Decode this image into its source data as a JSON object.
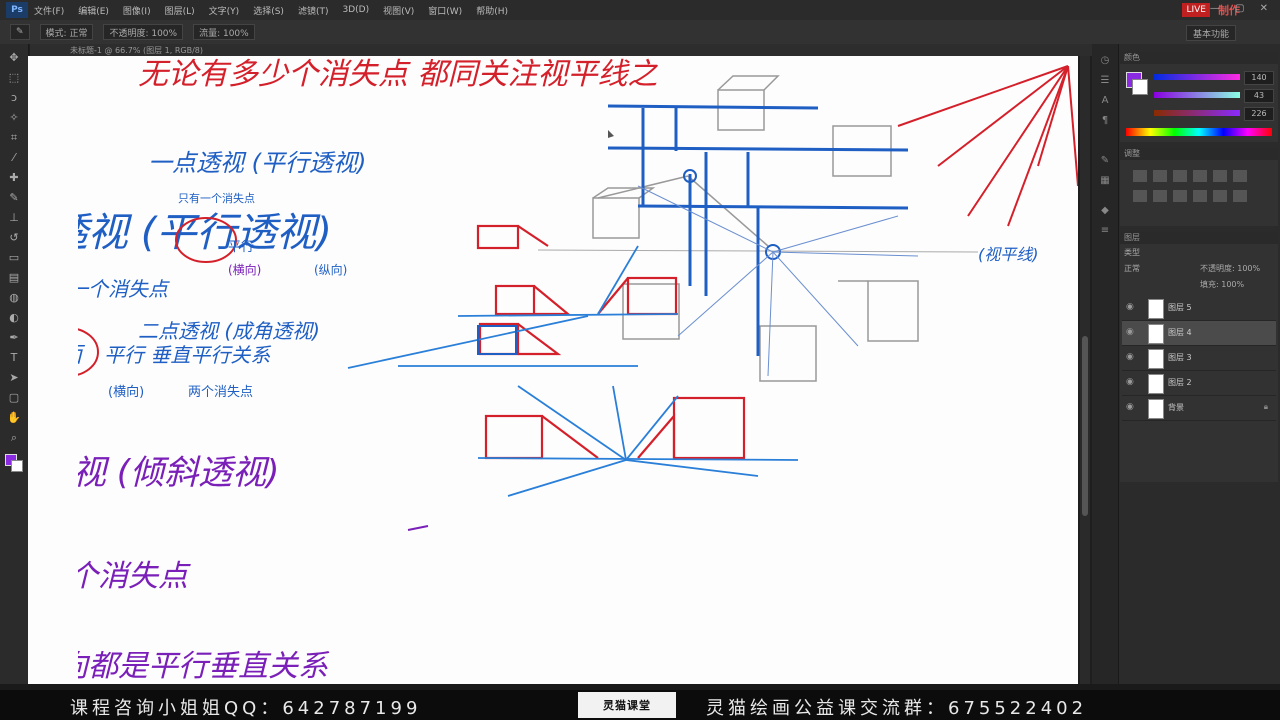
{
  "app": {
    "menus": [
      "文件(F)",
      "编辑(E)",
      "图像(I)",
      "图层(L)",
      "文字(Y)",
      "选择(S)",
      "滤镜(T)",
      "3D(D)",
      "视图(V)",
      "窗口(W)",
      "帮助(H)"
    ],
    "live_badge": "LIVE",
    "live_label": "制作",
    "window_controls": "— ▢ ✕"
  },
  "options": {
    "mode_label": "模式: 正常",
    "opacity_label": "不透明度: 100%",
    "flow_label": "流量: 100%",
    "workspace": "基本功能"
  },
  "document": {
    "tab_title": "未标题-1 @ 66.7% (图层 1, RGB/8)"
  },
  "canvas": {
    "heading_red": "无论有多少个消失点 都同关注视平线之",
    "line_one_point": "一点透视 (平行透视)",
    "note_one_vp": "只有一个消失点",
    "line_big_one_point": "透视 (平行透视)",
    "line_one_vp_left": "有一个消失点",
    "label_horizontal": "(横向)",
    "label_vertical": "(纵向)",
    "label_parallel": "平行",
    "line_two_point": "二点透视 (成角透视)",
    "line_face": "对面",
    "line_parallel_vertical": "平行 垂直平行关系",
    "label_horiz2": "(横向)",
    "label_two_vp": "两个消失点",
    "line_three_point": "透视 (倾斜透视)",
    "line_two_vp": "两个消失点",
    "line_all_parallel": "纵向都是平行垂直关系",
    "label_horizon": "(视平线)"
  },
  "panels": {
    "color_tab": "颜色",
    "r_value": "140",
    "g_value": "43",
    "b_value": "226",
    "adjust_tab": "调整",
    "layers_tab": "图层",
    "kind_label": "类型",
    "blend_mode": "正常",
    "opacity": "不透明度: 100%",
    "fill": "填充: 100%",
    "layers": [
      {
        "name": "图层 5",
        "active": false
      },
      {
        "name": "图层 4",
        "active": true
      },
      {
        "name": "图层 3",
        "active": false
      },
      {
        "name": "图层 2",
        "active": false
      },
      {
        "name": "背景",
        "active": false
      }
    ]
  },
  "banner": {
    "left_text": "课程咨询小姐姐QQ：642787199",
    "brand": "灵猫课堂",
    "right_text": "灵猫绘画公益课交流群：675522402"
  },
  "colors": {
    "red_ink": "#d4202a",
    "blue_ink": "#1f5fc4",
    "purple_ink": "#7a1fb8",
    "pen_blue": "#1a6fd8"
  }
}
